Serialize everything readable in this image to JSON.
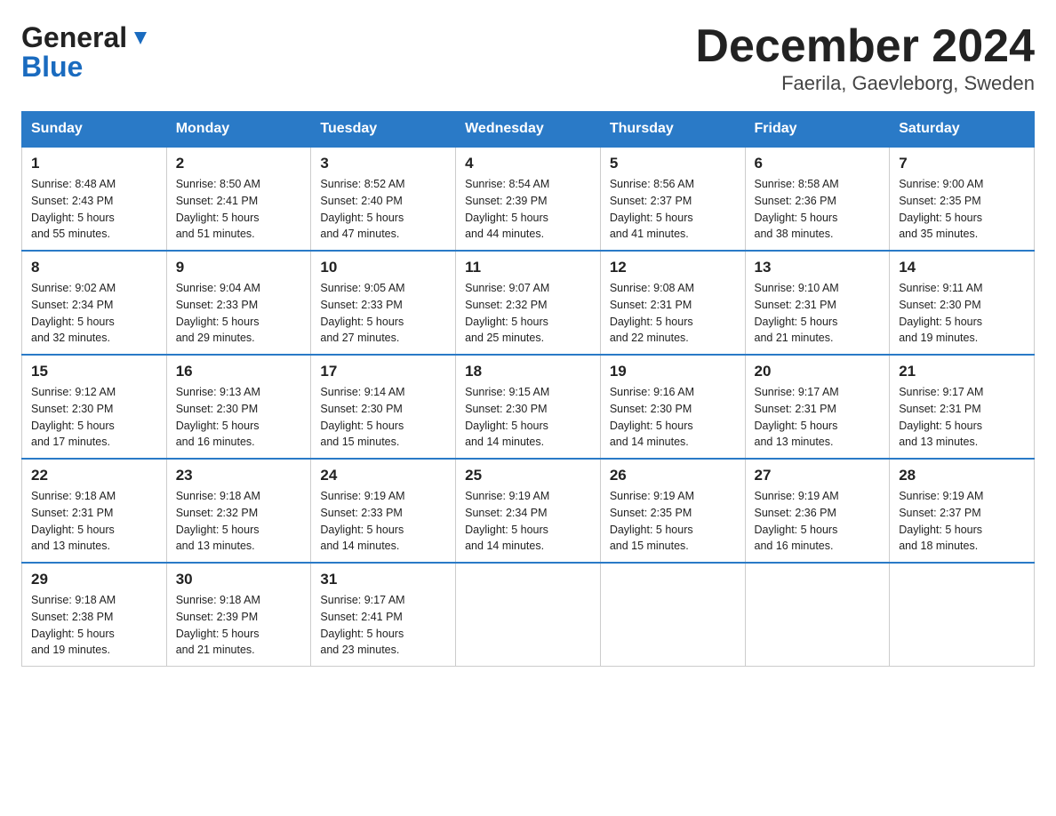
{
  "header": {
    "title": "December 2024",
    "subtitle": "Faerila, Gaevleborg, Sweden",
    "logo_general": "General",
    "logo_blue": "Blue"
  },
  "days_of_week": [
    "Sunday",
    "Monday",
    "Tuesday",
    "Wednesday",
    "Thursday",
    "Friday",
    "Saturday"
  ],
  "weeks": [
    [
      {
        "day": 1,
        "sunrise": "8:48 AM",
        "sunset": "2:43 PM",
        "daylight": "5 hours and 55 minutes."
      },
      {
        "day": 2,
        "sunrise": "8:50 AM",
        "sunset": "2:41 PM",
        "daylight": "5 hours and 51 minutes."
      },
      {
        "day": 3,
        "sunrise": "8:52 AM",
        "sunset": "2:40 PM",
        "daylight": "5 hours and 47 minutes."
      },
      {
        "day": 4,
        "sunrise": "8:54 AM",
        "sunset": "2:39 PM",
        "daylight": "5 hours and 44 minutes."
      },
      {
        "day": 5,
        "sunrise": "8:56 AM",
        "sunset": "2:37 PM",
        "daylight": "5 hours and 41 minutes."
      },
      {
        "day": 6,
        "sunrise": "8:58 AM",
        "sunset": "2:36 PM",
        "daylight": "5 hours and 38 minutes."
      },
      {
        "day": 7,
        "sunrise": "9:00 AM",
        "sunset": "2:35 PM",
        "daylight": "5 hours and 35 minutes."
      }
    ],
    [
      {
        "day": 8,
        "sunrise": "9:02 AM",
        "sunset": "2:34 PM",
        "daylight": "5 hours and 32 minutes."
      },
      {
        "day": 9,
        "sunrise": "9:04 AM",
        "sunset": "2:33 PM",
        "daylight": "5 hours and 29 minutes."
      },
      {
        "day": 10,
        "sunrise": "9:05 AM",
        "sunset": "2:33 PM",
        "daylight": "5 hours and 27 minutes."
      },
      {
        "day": 11,
        "sunrise": "9:07 AM",
        "sunset": "2:32 PM",
        "daylight": "5 hours and 25 minutes."
      },
      {
        "day": 12,
        "sunrise": "9:08 AM",
        "sunset": "2:31 PM",
        "daylight": "5 hours and 22 minutes."
      },
      {
        "day": 13,
        "sunrise": "9:10 AM",
        "sunset": "2:31 PM",
        "daylight": "5 hours and 21 minutes."
      },
      {
        "day": 14,
        "sunrise": "9:11 AM",
        "sunset": "2:30 PM",
        "daylight": "5 hours and 19 minutes."
      }
    ],
    [
      {
        "day": 15,
        "sunrise": "9:12 AM",
        "sunset": "2:30 PM",
        "daylight": "5 hours and 17 minutes."
      },
      {
        "day": 16,
        "sunrise": "9:13 AM",
        "sunset": "2:30 PM",
        "daylight": "5 hours and 16 minutes."
      },
      {
        "day": 17,
        "sunrise": "9:14 AM",
        "sunset": "2:30 PM",
        "daylight": "5 hours and 15 minutes."
      },
      {
        "day": 18,
        "sunrise": "9:15 AM",
        "sunset": "2:30 PM",
        "daylight": "5 hours and 14 minutes."
      },
      {
        "day": 19,
        "sunrise": "9:16 AM",
        "sunset": "2:30 PM",
        "daylight": "5 hours and 14 minutes."
      },
      {
        "day": 20,
        "sunrise": "9:17 AM",
        "sunset": "2:31 PM",
        "daylight": "5 hours and 13 minutes."
      },
      {
        "day": 21,
        "sunrise": "9:17 AM",
        "sunset": "2:31 PM",
        "daylight": "5 hours and 13 minutes."
      }
    ],
    [
      {
        "day": 22,
        "sunrise": "9:18 AM",
        "sunset": "2:31 PM",
        "daylight": "5 hours and 13 minutes."
      },
      {
        "day": 23,
        "sunrise": "9:18 AM",
        "sunset": "2:32 PM",
        "daylight": "5 hours and 13 minutes."
      },
      {
        "day": 24,
        "sunrise": "9:19 AM",
        "sunset": "2:33 PM",
        "daylight": "5 hours and 14 minutes."
      },
      {
        "day": 25,
        "sunrise": "9:19 AM",
        "sunset": "2:34 PM",
        "daylight": "5 hours and 14 minutes."
      },
      {
        "day": 26,
        "sunrise": "9:19 AM",
        "sunset": "2:35 PM",
        "daylight": "5 hours and 15 minutes."
      },
      {
        "day": 27,
        "sunrise": "9:19 AM",
        "sunset": "2:36 PM",
        "daylight": "5 hours and 16 minutes."
      },
      {
        "day": 28,
        "sunrise": "9:19 AM",
        "sunset": "2:37 PM",
        "daylight": "5 hours and 18 minutes."
      }
    ],
    [
      {
        "day": 29,
        "sunrise": "9:18 AM",
        "sunset": "2:38 PM",
        "daylight": "5 hours and 19 minutes."
      },
      {
        "day": 30,
        "sunrise": "9:18 AM",
        "sunset": "2:39 PM",
        "daylight": "5 hours and 21 minutes."
      },
      {
        "day": 31,
        "sunrise": "9:17 AM",
        "sunset": "2:41 PM",
        "daylight": "5 hours and 23 minutes."
      },
      null,
      null,
      null,
      null
    ]
  ]
}
